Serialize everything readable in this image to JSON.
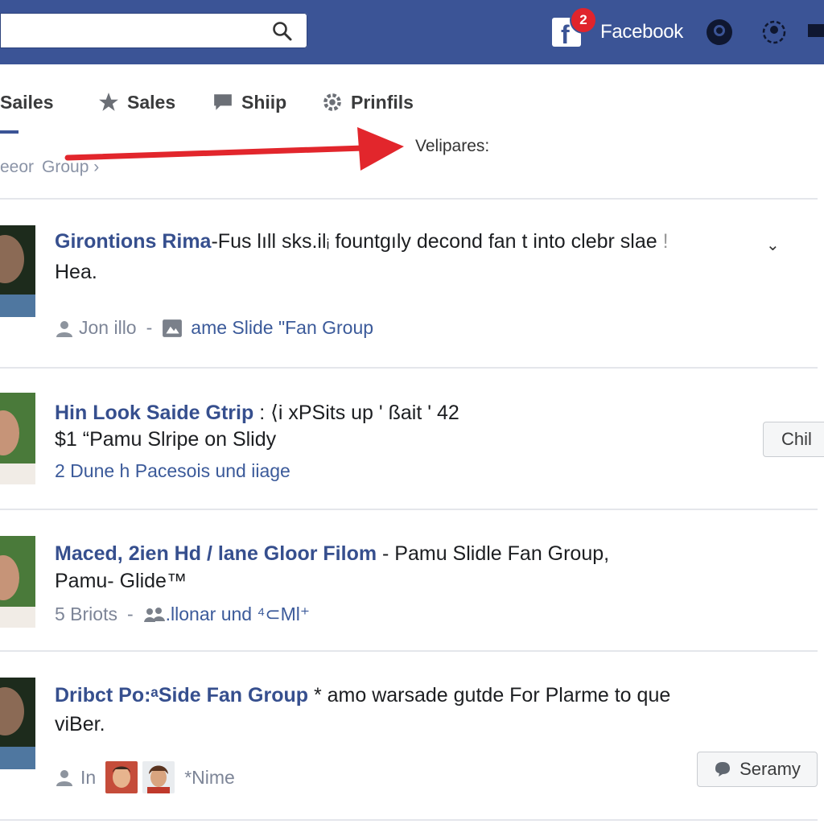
{
  "topbar": {
    "search_placeholder": "",
    "notification_count": "2",
    "brand": "Facebook",
    "colors": {
      "bar": "#3b5496",
      "badge": "#e0242c"
    }
  },
  "tabs": [
    {
      "label": "Sailes"
    },
    {
      "label": "Sales",
      "icon": "star-icon"
    },
    {
      "label": "Shiip",
      "icon": "speech-bubble-icon"
    },
    {
      "label": "Prinfils",
      "icon": "gear-icon"
    }
  ],
  "callout": {
    "text": "Velipares:"
  },
  "breadcrumb": {
    "part1": "eeor",
    "part2": "Group",
    "arrow": "›"
  },
  "posts": [
    {
      "title": "Girontions Rima",
      "text": "-Fus lıll sks.ilᵢ fountgıly decond fan t into clebr slae",
      "text_end": "!",
      "line2": "Hea.",
      "meta_user": "Jon illo",
      "meta_sep": "-",
      "meta_group": "ame Slide \"Fan Group"
    },
    {
      "title": "Hin Look Saide Gtrip",
      "text": " : ⟨i xPSits up ' ßait ' 42",
      "line2": "$1 “Pamu Slripe on Slidy",
      "meta_text": "2 Dune h Pacesois und iiage",
      "button": "Chil"
    },
    {
      "title": "Maced, 2ien Hd / lane Gloor Filom",
      "text": " - Pamu Slidle Fan Group,",
      "line2": "Pamu- Glide™",
      "meta_count": "5 Briots",
      "meta_sep": "-",
      "meta_link": ".llonar und ⁴⊂Ml⁺"
    },
    {
      "title": "Dribct Po:ᵃSide Fan Group",
      "text": " * amo warsade gutde For Plarme to que",
      "line2": "viBer.",
      "meta_label": "In",
      "meta_name": "*Nime",
      "button": "Seramy"
    }
  ]
}
